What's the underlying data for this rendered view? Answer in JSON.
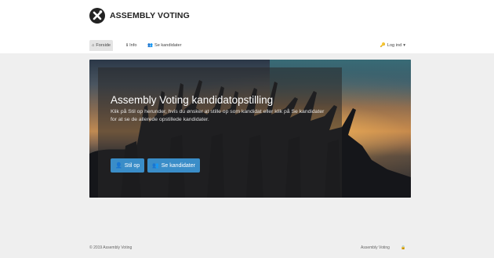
{
  "brand": {
    "name": "ASSEMBLY VOTING"
  },
  "nav": {
    "forside": "Forside",
    "info": "Info",
    "kandidater": "Se kandidater",
    "login": "Log ind"
  },
  "hero": {
    "title": "Assembly Voting kandidatopstilling",
    "description": "Klik på Stil op herunder, hvis du ønsker at stille op som kandidat eller klik på Se kandidater for at se de allerede opstillede kandidater.",
    "btn_stil": "Stil op",
    "btn_se": "Se kandidater"
  },
  "footer": {
    "copyright": "© 2019 Assembly Voting",
    "right": "Assembly Voting"
  },
  "colors": {
    "accent": "#3a8dc8",
    "background": "#efefef"
  },
  "icons": [
    "home-icon",
    "info-icon",
    "users-icon",
    "login-icon",
    "user-icon",
    "lock-icon"
  ]
}
